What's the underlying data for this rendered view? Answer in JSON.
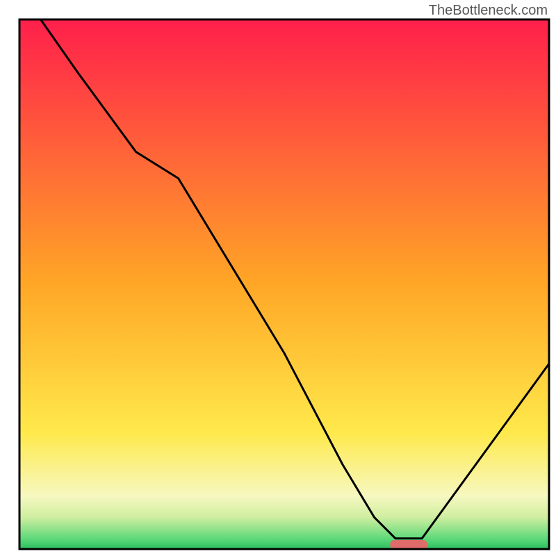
{
  "watermark": "TheBottleneck.com",
  "chart_data": {
    "type": "line",
    "title": "",
    "xlabel": "",
    "ylabel": "",
    "xlim": [
      0,
      100
    ],
    "ylim": [
      0,
      100
    ],
    "background_gradient": {
      "stops": [
        {
          "offset": 0,
          "color": "#ff1f4b"
        },
        {
          "offset": 50,
          "color": "#ffa726"
        },
        {
          "offset": 78,
          "color": "#ffe94b"
        },
        {
          "offset": 90,
          "color": "#f6f8c0"
        },
        {
          "offset": 94,
          "color": "#cfeea0"
        },
        {
          "offset": 98,
          "color": "#5fd97a"
        },
        {
          "offset": 100,
          "color": "#2bbf5f"
        }
      ]
    },
    "series": [
      {
        "name": "bottleneck-curve",
        "type": "line",
        "color": "#000000",
        "x": [
          4,
          11,
          22,
          30,
          50,
          61,
          67,
          71,
          76,
          100
        ],
        "values": [
          100,
          90,
          75,
          70,
          37,
          16,
          6,
          2,
          2,
          35
        ]
      }
    ],
    "marker": {
      "name": "optimal-range",
      "color": "#e06b6b",
      "x_start": 70,
      "x_end": 77,
      "y": 0.8,
      "thickness": 1.8
    },
    "plot_border_color": "#000000"
  }
}
